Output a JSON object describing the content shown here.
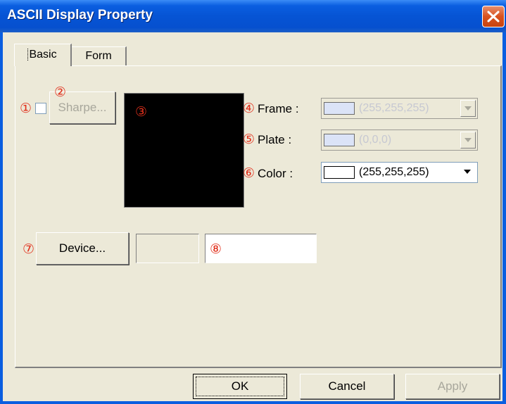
{
  "window": {
    "title": "ASCII Display Property"
  },
  "tabs": [
    {
      "label": "Basic",
      "selected": true
    },
    {
      "label": "Form",
      "selected": false
    }
  ],
  "basic": {
    "checkbox": {
      "checked": false
    },
    "sharpe_button": {
      "label": "Sharpe...",
      "enabled": false
    },
    "preview": {
      "background": "#000000"
    },
    "frame": {
      "label": "Frame :",
      "value": "(255,255,255)",
      "enabled": false,
      "swatch": "#dbe3f7"
    },
    "plate": {
      "label": "Plate :",
      "value": "(0,0,0)",
      "enabled": false,
      "swatch": "#dbe3f7"
    },
    "color": {
      "label": "Color :",
      "value": "(255,255,255)",
      "enabled": true,
      "swatch": "#ffffff"
    },
    "device_button": {
      "label": "Device...",
      "enabled": true
    },
    "device_code": "",
    "device_name": ""
  },
  "callouts": [
    "①",
    "②",
    "③",
    "④",
    "⑤",
    "⑥",
    "⑦",
    "⑧"
  ],
  "footer": {
    "ok": "OK",
    "cancel": "Cancel",
    "apply": "Apply"
  },
  "colors": {
    "titlebar": "#0a5ee0",
    "dialog_bg": "#ece9d8",
    "callout": "#e1301c",
    "disabled_text": "#a8a79c"
  }
}
